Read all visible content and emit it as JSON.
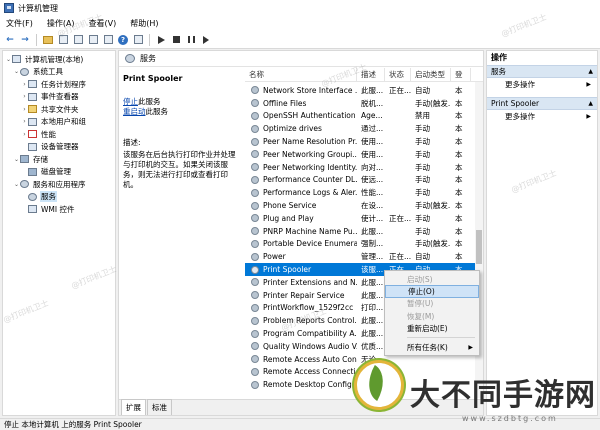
{
  "window": {
    "title": "计算机管理"
  },
  "menu": [
    "文件(F)",
    "操作(A)",
    "查看(V)",
    "帮助(H)"
  ],
  "tree": [
    {
      "label": "计算机管理(本地)",
      "indent": 0,
      "arrow": "⌄",
      "icon": "computer"
    },
    {
      "label": "系统工具",
      "indent": 1,
      "arrow": "⌄",
      "icon": "gear"
    },
    {
      "label": "任务计划程序",
      "indent": 2,
      "arrow": "›",
      "icon": "box"
    },
    {
      "label": "事件查看器",
      "indent": 2,
      "arrow": "›",
      "icon": "box"
    },
    {
      "label": "共享文件夹",
      "indent": 2,
      "arrow": "›",
      "icon": "shared"
    },
    {
      "label": "本地用户和组",
      "indent": 2,
      "arrow": "›",
      "icon": "box"
    },
    {
      "label": "性能",
      "indent": 2,
      "arrow": "›",
      "icon": "perf"
    },
    {
      "label": "设备管理器",
      "indent": 2,
      "arrow": "",
      "icon": "box"
    },
    {
      "label": "存储",
      "indent": 1,
      "arrow": "⌄",
      "icon": "disk"
    },
    {
      "label": "磁盘管理",
      "indent": 2,
      "arrow": "",
      "icon": "disk"
    },
    {
      "label": "服务和应用程序",
      "indent": 1,
      "arrow": "⌄",
      "icon": "gear"
    },
    {
      "label": "服务",
      "indent": 2,
      "arrow": "",
      "icon": "gear",
      "selected": true
    },
    {
      "label": "WMI 控件",
      "indent": 2,
      "arrow": "",
      "icon": "box"
    }
  ],
  "center": {
    "header": "服务",
    "detail_title": "Print Spooler",
    "stop_link": "停止",
    "stop_suffix": "此服务",
    "restart_link": "重启动",
    "restart_suffix": "此服务",
    "desc_label": "描述:",
    "description": "该服务在后台执行打印作业并处理与打印机的交互。如果关闭该服务，则无法进行打印或查看打印机。"
  },
  "list": {
    "columns": [
      "名称",
      "描述",
      "状态",
      "启动类型",
      "登"
    ],
    "rows": [
      {
        "name": "Network Store Interface ...",
        "desc": "此服...",
        "status": "正在...",
        "start": "自动",
        "login": "本"
      },
      {
        "name": "Offline Files",
        "desc": "脱机...",
        "status": "",
        "start": "手动(触发...",
        "login": "本"
      },
      {
        "name": "OpenSSH Authentication ...",
        "desc": "Age...",
        "status": "",
        "start": "禁用",
        "login": "本"
      },
      {
        "name": "Optimize drives",
        "desc": "通过...",
        "status": "",
        "start": "手动",
        "login": "本"
      },
      {
        "name": "Peer Name Resolution Pr...",
        "desc": "使用...",
        "status": "",
        "start": "手动",
        "login": "本"
      },
      {
        "name": "Peer Networking Groupi...",
        "desc": "使用...",
        "status": "",
        "start": "手动",
        "login": "本"
      },
      {
        "name": "Peer Networking Identity...",
        "desc": "向对...",
        "status": "",
        "start": "手动",
        "login": "本"
      },
      {
        "name": "Performance Counter DL...",
        "desc": "使远...",
        "status": "",
        "start": "手动",
        "login": "本"
      },
      {
        "name": "Performance Logs & Aler...",
        "desc": "性能...",
        "status": "",
        "start": "手动",
        "login": "本"
      },
      {
        "name": "Phone Service",
        "desc": "在设...",
        "status": "",
        "start": "手动(触发...",
        "login": "本"
      },
      {
        "name": "Plug and Play",
        "desc": "使计...",
        "status": "正在...",
        "start": "手动",
        "login": "本"
      },
      {
        "name": "PNRP Machine Name Pu...",
        "desc": "此服...",
        "status": "",
        "start": "手动",
        "login": "本"
      },
      {
        "name": "Portable Device Enumera...",
        "desc": "强制...",
        "status": "",
        "start": "手动(触发...",
        "login": "本"
      },
      {
        "name": "Power",
        "desc": "管理...",
        "status": "正在...",
        "start": "自动",
        "login": "本"
      },
      {
        "name": "Print Spooler",
        "desc": "该服...",
        "status": "正在...",
        "start": "自动",
        "login": "本",
        "selected": true
      },
      {
        "name": "Printer Extensions and N...",
        "desc": "此服...",
        "status": "",
        "start": "",
        "login": ""
      },
      {
        "name": "Printer Repair Service",
        "desc": "此服...",
        "status": "",
        "start": "",
        "login": ""
      },
      {
        "name": "PrintWorkflow_1529f2cc",
        "desc": "打印...",
        "status": "",
        "start": "",
        "login": ""
      },
      {
        "name": "Problem Reports Control...",
        "desc": "此服...",
        "status": "",
        "start": "",
        "login": ""
      },
      {
        "name": "Program Compatibility A...",
        "desc": "此服...",
        "status": "",
        "start": "",
        "login": ""
      },
      {
        "name": "Quality Windows Audio V...",
        "desc": "优质...",
        "status": "",
        "start": "",
        "login": ""
      },
      {
        "name": "Remote Access Auto Con...",
        "desc": "无论...",
        "status": "",
        "start": "",
        "login": ""
      },
      {
        "name": "Remote Access Connecti...",
        "desc": "管理...",
        "status": "",
        "start": "",
        "login": ""
      },
      {
        "name": "Remote Desktop Config...",
        "desc": "远程...",
        "status": "",
        "start": "",
        "login": ""
      }
    ]
  },
  "tabs": [
    "扩展",
    "标准"
  ],
  "actions": {
    "title": "操作",
    "sections": [
      {
        "label": "服务",
        "items": [
          "更多操作"
        ]
      },
      {
        "label": "Print Spooler",
        "items": [
          "更多操作"
        ]
      }
    ]
  },
  "context_menu": {
    "items": [
      {
        "label": "启动(S)",
        "disabled": true
      },
      {
        "label": "停止(O)",
        "disabled": false,
        "hover": true
      },
      {
        "label": "暂停(U)",
        "disabled": true
      },
      {
        "label": "恢复(M)",
        "disabled": true
      },
      {
        "label": "重新启动(E)",
        "disabled": false
      },
      {
        "sep": true
      },
      {
        "label": "所有任务(K)",
        "disabled": false,
        "submenu": true
      }
    ]
  },
  "statusbar": "停止 本地计算机 上的服务 Print Spooler",
  "watermarks": [
    "@打印机卫士"
  ],
  "logo": {
    "brand": "大不同手游网",
    "url": "www.szdbtg.com"
  }
}
